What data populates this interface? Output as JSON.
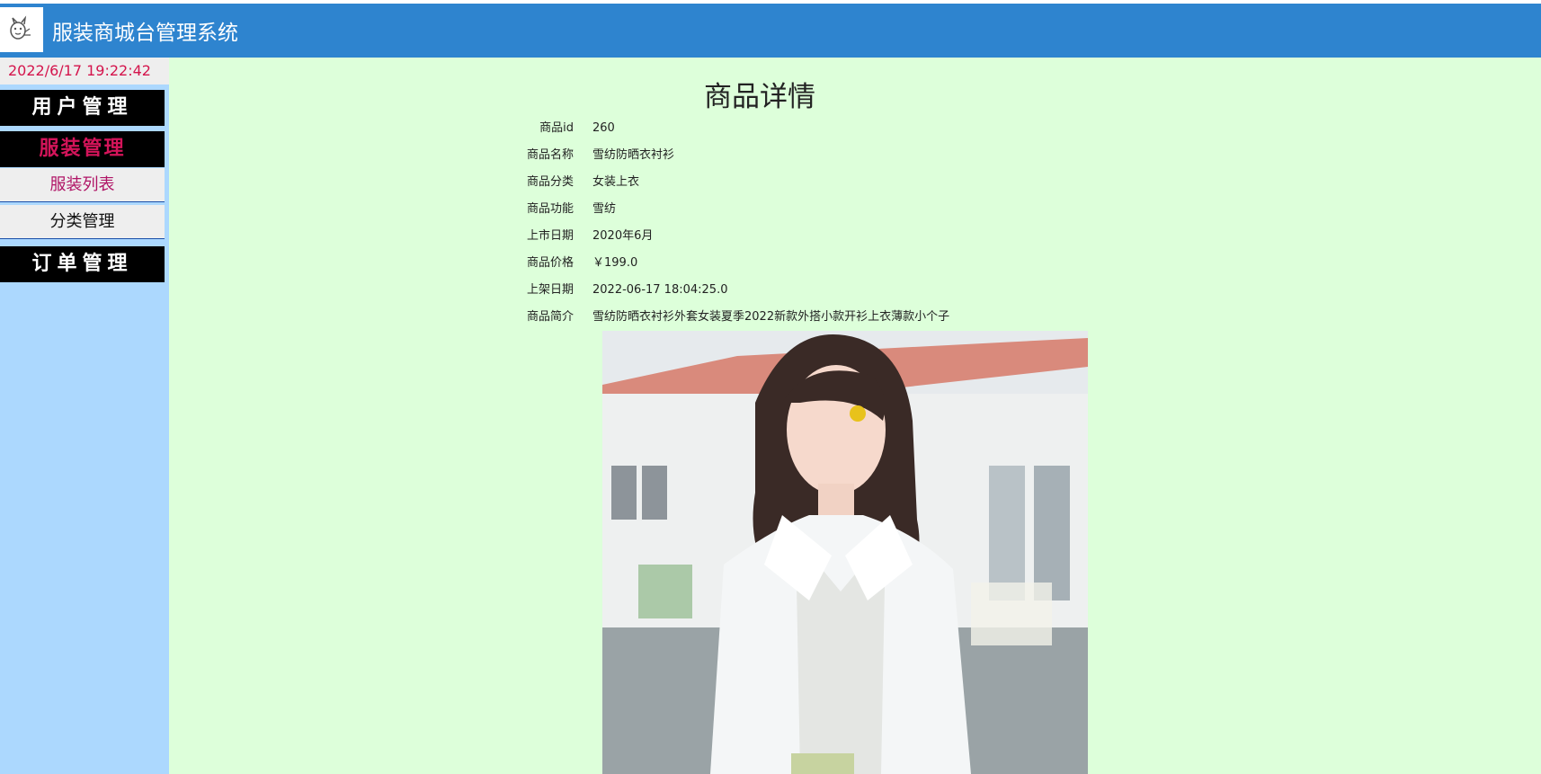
{
  "app": {
    "title": "服装商城台管理系统"
  },
  "sidebar": {
    "datetime": "2022/6/17 19:22:42",
    "menus": [
      {
        "label": "用户管理"
      },
      {
        "label": "服装管理",
        "items": [
          {
            "label": "服装列表"
          },
          {
            "label": "分类管理"
          }
        ]
      },
      {
        "label": "订单管理"
      }
    ]
  },
  "page": {
    "title": "商品详情"
  },
  "product": {
    "fields": [
      {
        "label": "商品id",
        "value": "260"
      },
      {
        "label": "商品名称",
        "value": "雪纺防晒衣衬衫"
      },
      {
        "label": "商品分类",
        "value": "女装上衣"
      },
      {
        "label": "商品功能",
        "value": "雪纺"
      },
      {
        "label": "上市日期",
        "value": "2020年6月"
      },
      {
        "label": "商品价格",
        "value": "￥199.0"
      },
      {
        "label": "上架日期",
        "value": "2022-06-17 18:04:25.0"
      },
      {
        "label": "商品简介",
        "value": "雪纺防晒衣衬衫外套女装夏季2022新款外搭小款开衫上衣薄款小个子"
      }
    ]
  },
  "colors": {
    "header": "#2e84cf",
    "sidebar": "#acd8fe",
    "content": "#ddffda",
    "accent": "#d4145a"
  }
}
